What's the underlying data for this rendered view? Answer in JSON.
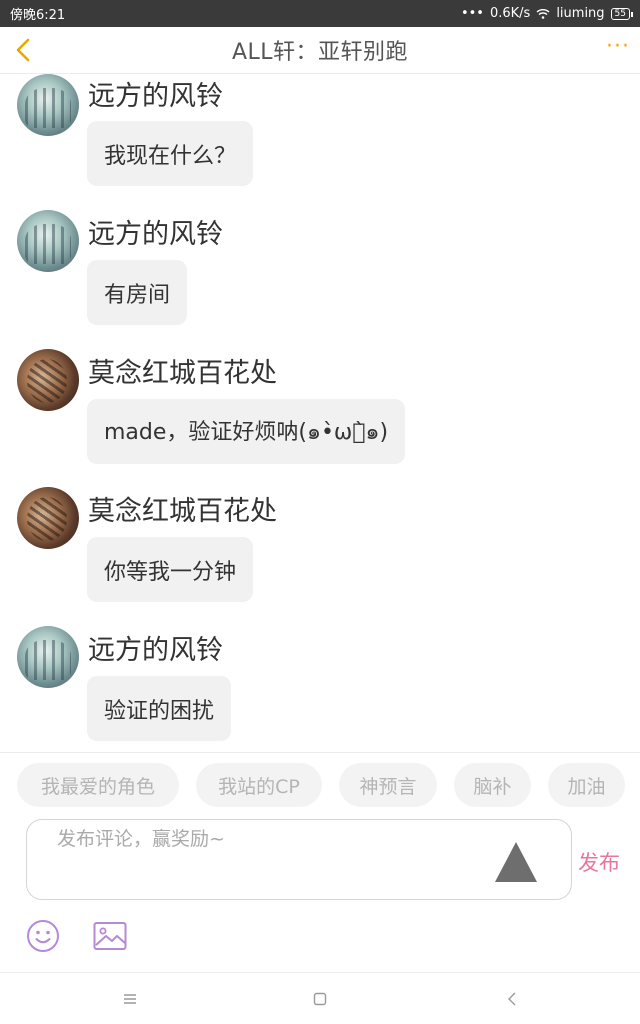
{
  "status_bar": {
    "time": "傍晚6:21",
    "net_speed": "0.6K/s",
    "carrier": "liuming",
    "battery": "55"
  },
  "header": {
    "title": "ALL轩：亚轩别跑",
    "more_label": "···"
  },
  "messages": [
    {
      "user": "远方的风铃",
      "text": "我现在什么？",
      "avatar": "avatar-a"
    },
    {
      "user": "远方的风铃",
      "text": "有房间",
      "avatar": "avatar-a"
    },
    {
      "user": "莫念红城百花处",
      "text": "made，验证好烦呐(๑•̀ωก̀๑)",
      "avatar": "avatar-b"
    },
    {
      "user": "莫念红城百花处",
      "text": "你等我一分钟",
      "avatar": "avatar-b"
    },
    {
      "user": "远方的风铃",
      "text": "验证的困扰",
      "avatar": "avatar-a"
    }
  ],
  "quick_tags": [
    "我最爱的角色",
    "我站的CP",
    "神预言",
    "脑补",
    "加油"
  ],
  "composer": {
    "placeholder": "发布评论，赢奖励~",
    "publish_label": "发布"
  },
  "colors": {
    "accent_back": "#e6a900",
    "accent_more": "#f5a623",
    "publish": "#e8769b",
    "icon_purple": "#b689d6"
  }
}
